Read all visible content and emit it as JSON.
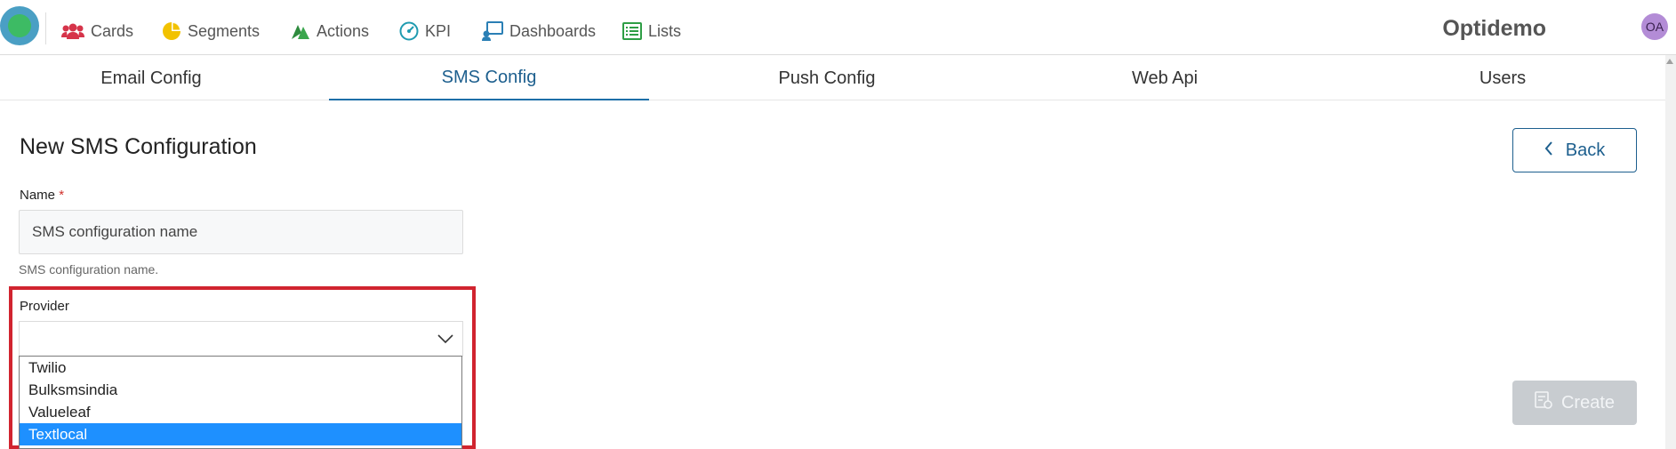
{
  "nav": {
    "items": [
      {
        "label": "Cards",
        "icon": "users-icon"
      },
      {
        "label": "Segments",
        "icon": "pie-chart-icon"
      },
      {
        "label": "Actions",
        "icon": "actions-icon"
      },
      {
        "label": "KPI",
        "icon": "gauge-icon"
      },
      {
        "label": "Dashboards",
        "icon": "dashboard-icon"
      },
      {
        "label": "Lists",
        "icon": "list-icon"
      }
    ],
    "brand": "Optidemo",
    "avatar_initials": "OA"
  },
  "tabs": [
    {
      "label": "Email Config",
      "active": false
    },
    {
      "label": "SMS Config",
      "active": true
    },
    {
      "label": "Push Config",
      "active": false
    },
    {
      "label": "Web Api",
      "active": false
    },
    {
      "label": "Users",
      "active": false
    }
  ],
  "form": {
    "title": "New SMS Configuration",
    "back_label": "Back",
    "name_label": "Name",
    "required_mark": "*",
    "name_value": "SMS configuration name",
    "name_help": "SMS configuration name.",
    "provider_label": "Provider",
    "provider_value": "",
    "provider_options": [
      "Twilio",
      "Bulksmsindia",
      "Valueleaf",
      "Textlocal"
    ],
    "provider_highlighted": "Textlocal",
    "create_label": "Create"
  },
  "colors": {
    "accent": "#1d5f8e",
    "highlight_border": "#d1242f",
    "selected_option": "#1e90ff",
    "disabled_button": "#c8ccd0"
  }
}
